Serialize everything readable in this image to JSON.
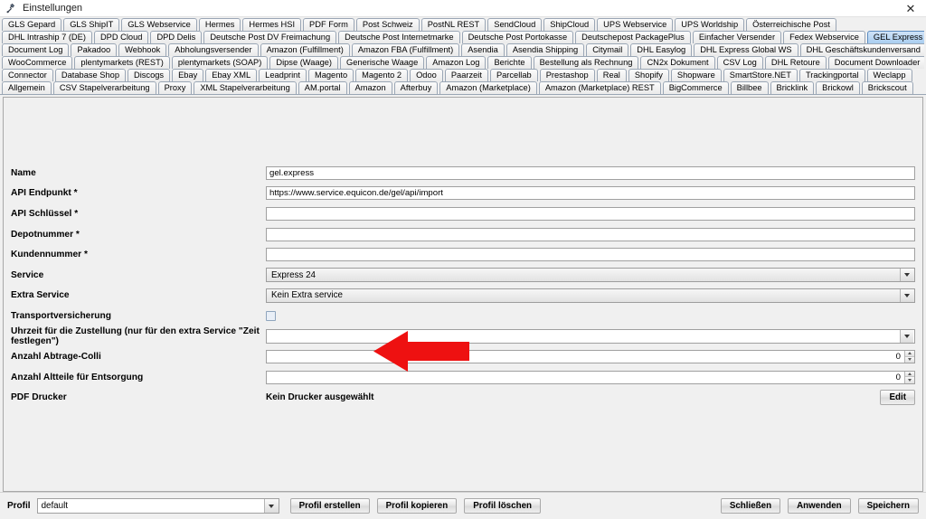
{
  "window": {
    "title": "Einstellungen",
    "app_icon": "settings-app-icon",
    "close_label": "✕"
  },
  "tabs": {
    "selected": "GEL Express",
    "rows": [
      [
        "GLS Gepard",
        "GLS ShipIT",
        "GLS Webservice",
        "Hermes",
        "Hermes HSI",
        "PDF Form",
        "Post Schweiz",
        "PostNL REST",
        "SendCloud",
        "ShipCloud",
        "UPS Webservice",
        "UPS Worldship",
        "Österreichische Post"
      ],
      [
        "DHL Intraship 7 (DE)",
        "DPD Cloud",
        "DPD Delis",
        "Deutsche Post DV Freimachung",
        "Deutsche Post Internetmarke",
        "Deutsche Post Portokasse",
        "Deutschepost PackagePlus",
        "Einfacher Versender",
        "Fedex Webservice",
        "GEL Express"
      ],
      [
        "Document Log",
        "Pakadoo",
        "Webhook",
        "Abholungsversender",
        "Amazon (Fulfillment)",
        "Amazon FBA (Fulfillment)",
        "Asendia",
        "Asendia Shipping",
        "Citymail",
        "DHL Easylog",
        "DHL Express Global WS",
        "DHL Geschäftskundenversand"
      ],
      [
        "WooCommerce",
        "plentymarkets (REST)",
        "plentymarkets (SOAP)",
        "Dipse (Waage)",
        "Generische Waage",
        "Amazon Log",
        "Berichte",
        "Bestellung als Rechnung",
        "CN2x Dokument",
        "CSV Log",
        "DHL Retoure",
        "Document Downloader"
      ],
      [
        "Connector",
        "Database Shop",
        "Discogs",
        "Ebay",
        "Ebay XML",
        "Leadprint",
        "Magento",
        "Magento 2",
        "Odoo",
        "Paarzeit",
        "Parcellab",
        "Prestashop",
        "Real",
        "Shopify",
        "Shopware",
        "SmartStore.NET",
        "Trackingportal",
        "Weclapp"
      ],
      [
        "Allgemein",
        "CSV Stapelverarbeitung",
        "Proxy",
        "XML Stapelverarbeitung",
        "AM.portal",
        "Amazon",
        "Afterbuy",
        "Amazon (Marketplace)",
        "Amazon (Marketplace) REST",
        "BigCommerce",
        "Billbee",
        "Bricklink",
        "Brickowl",
        "Brickscout"
      ]
    ]
  },
  "form": {
    "fields": [
      {
        "label": "Name",
        "type": "text",
        "value": "gel.express",
        "placeholder": "",
        "name": "name-field"
      },
      {
        "label": "API Endpunkt *",
        "type": "text",
        "value": "https://www.service.equicon.de/gel/api/import",
        "placeholder": "",
        "name": "api-endpunkt-field"
      },
      {
        "label": "API Schlüssel *",
        "type": "text",
        "value": "",
        "placeholder": "",
        "name": "api-schluessel-field"
      },
      {
        "label": "Depotnummer *",
        "type": "text",
        "value": "",
        "placeholder": "",
        "name": "depotnummer-field"
      },
      {
        "label": "Kundennummer *",
        "type": "text",
        "value": "",
        "placeholder": "",
        "name": "kundennummer-field"
      },
      {
        "label": "Service",
        "type": "combo",
        "value": "Express 24",
        "name": "service-combo"
      },
      {
        "label": "Extra Service",
        "type": "combo",
        "value": "Kein Extra service",
        "name": "extra-service-combo"
      },
      {
        "label": "Transportversicherung",
        "type": "checkbox",
        "value": "",
        "checked": false,
        "name": "transportversicherung-checkbox"
      },
      {
        "label": "Uhrzeit für die Zustellung (nur für den extra Service \"Zeit festlegen\")",
        "type": "combo-white",
        "value": "",
        "name": "uhrzeit-zustellung-combo"
      },
      {
        "label": "Anzahl Abtrage-Colli",
        "type": "spinner",
        "value": "0",
        "name": "anzahl-abtrage-colli-spinner"
      },
      {
        "label": "Anzahl Altteile für Entsorgung",
        "type": "spinner",
        "value": "0",
        "name": "anzahl-altteile-entsorgung-spinner"
      },
      {
        "label": "PDF Drucker",
        "type": "static-button",
        "value": "Kein Drucker ausgewählt",
        "button": "Edit",
        "name": "pdf-drucker-row"
      }
    ]
  },
  "bottombar": {
    "profil_label": "Profil",
    "profil_value": "default",
    "profil_erstellen": "Profil erstellen",
    "profil_kopieren": "Profil kopieren",
    "profil_loeschen": "Profil löschen",
    "schliessen": "Schließen",
    "anwenden": "Anwenden",
    "speichern": "Speichern"
  },
  "annotation": {
    "arrow_color": "#ee1111",
    "arrow_name": "red-pointer-arrow"
  }
}
